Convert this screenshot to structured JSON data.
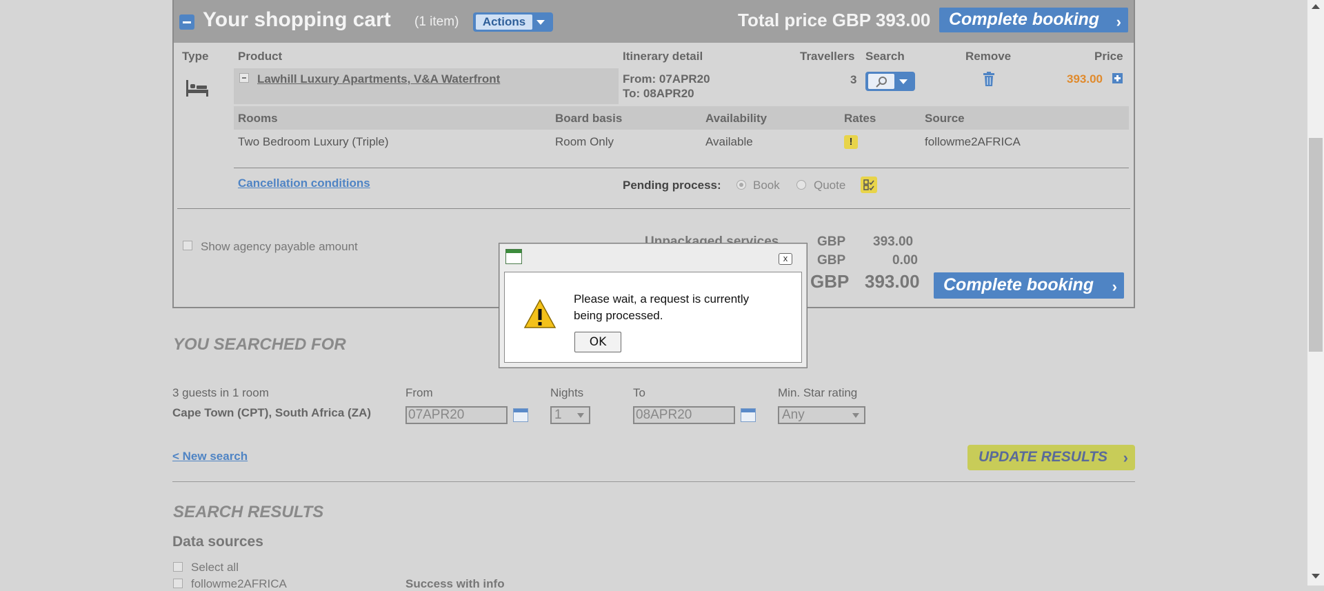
{
  "cart": {
    "title": "Your shopping cart",
    "item_count": "(1 item)",
    "actions_label": "Actions",
    "total_label": "Total price GBP 393.00",
    "complete_booking_label": "Complete booking",
    "columns": {
      "type": "Type",
      "product": "Product",
      "itinerary": "Itinerary detail",
      "travellers": "Travellers",
      "search": "Search",
      "remove": "Remove",
      "price": "Price"
    },
    "item": {
      "product_name": "Lawhill Luxury Apartments, V&A Waterfront",
      "from": "From: 07APR20",
      "to": "To: 08APR20",
      "travellers": "3",
      "price": "393.00"
    },
    "room_columns": {
      "rooms": "Rooms",
      "board_basis": "Board basis",
      "availability": "Availability",
      "rates": "Rates",
      "source": "Source"
    },
    "room": {
      "name": "Two Bedroom Luxury (Triple)",
      "board_basis": "Room Only",
      "availability": "Available",
      "rates_badge": "!",
      "source": "followme2AFRICA"
    },
    "cancellation_link": "Cancellation conditions",
    "pending_label": "Pending process:",
    "pending_options": [
      "Book",
      "Quote"
    ],
    "show_agency_label": "Show agency payable amount",
    "summary": {
      "unpackaged_label": "Unpackaged services",
      "rows": [
        {
          "currency": "GBP",
          "amount": "393.00"
        },
        {
          "currency": "GBP",
          "amount": "0.00"
        },
        {
          "currency": "GBP",
          "amount": "393.00"
        }
      ]
    }
  },
  "search": {
    "heading": "YOU SEARCHED FOR",
    "guests": "3 guests in 1 room",
    "destination": "Cape Town (CPT), South Africa (ZA)",
    "from_label": "From",
    "from_value": "07APR20",
    "nights_label": "Nights",
    "nights_value": "1",
    "to_label": "To",
    "to_value": "08APR20",
    "star_label": "Min. Star rating",
    "star_value": "Any",
    "new_search_link": "< New search",
    "update_label": "UPDATE RESULTS"
  },
  "results": {
    "heading": "SEARCH RESULTS",
    "data_sources_heading": "Data sources",
    "select_all": "Select all",
    "source_name": "followme2AFRICA",
    "status": "Success with info"
  },
  "dialog": {
    "message": "Please wait, a request is currently being processed.",
    "ok_label": "OK",
    "close_glyph": "x"
  },
  "colors": {
    "accent_blue": "#4f84c4",
    "price_orange": "#e08a2c",
    "update_yellow": "#c8cc58"
  }
}
